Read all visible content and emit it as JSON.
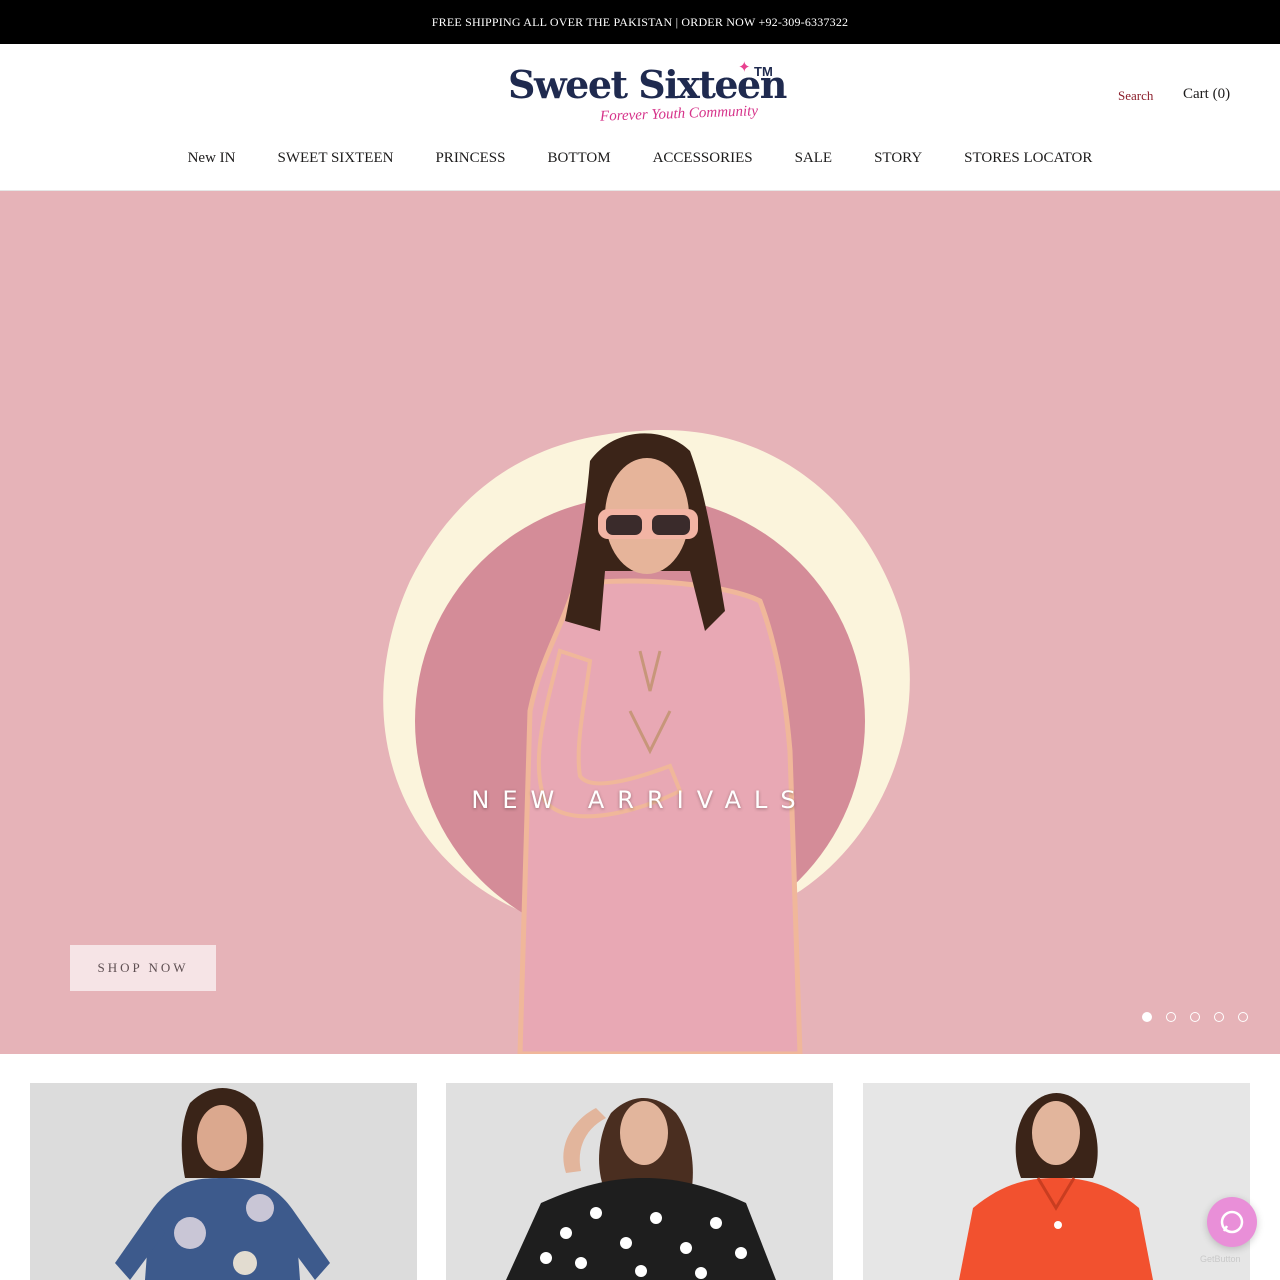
{
  "announcement": {
    "text": "FREE SHIPPING ALL OVER THE PAKISTAN | ORDER NOW +92-309-6337322"
  },
  "header": {
    "logo": {
      "name": "Sweet Sixteen",
      "trademark": "TM",
      "tagline": "Forever Youth Community"
    },
    "search_label": "Search",
    "cart_label": "Cart (0)"
  },
  "nav": {
    "items": [
      {
        "label": "New IN"
      },
      {
        "label": "SWEET SIXTEEN"
      },
      {
        "label": "PRINCESS"
      },
      {
        "label": "BOTTOM"
      },
      {
        "label": "ACCESSORIES"
      },
      {
        "label": "SALE"
      },
      {
        "label": "STORY"
      },
      {
        "label": "STORES LOCATOR"
      }
    ]
  },
  "hero": {
    "title": "NEW ARRIVALS",
    "cta_label": "SHOP NOW",
    "slide_count": 5,
    "active_slide": 1,
    "colors": {
      "background": "#e6b3b8",
      "cream_blob": "#fbf4dc",
      "circle": "#d48c98",
      "dress": "#e8a8b4"
    }
  },
  "products": [
    {
      "outfit": "blue floral dress",
      "color": "#3d5a8c"
    },
    {
      "outfit": "black polka dot cape top",
      "color": "#1e1e1e"
    },
    {
      "outfit": "orange shirt",
      "color": "#f2512f"
    }
  ],
  "chat_widget": {
    "icon": "chat-icon",
    "brand_label": "GetButton",
    "color": "#e98fd8"
  }
}
